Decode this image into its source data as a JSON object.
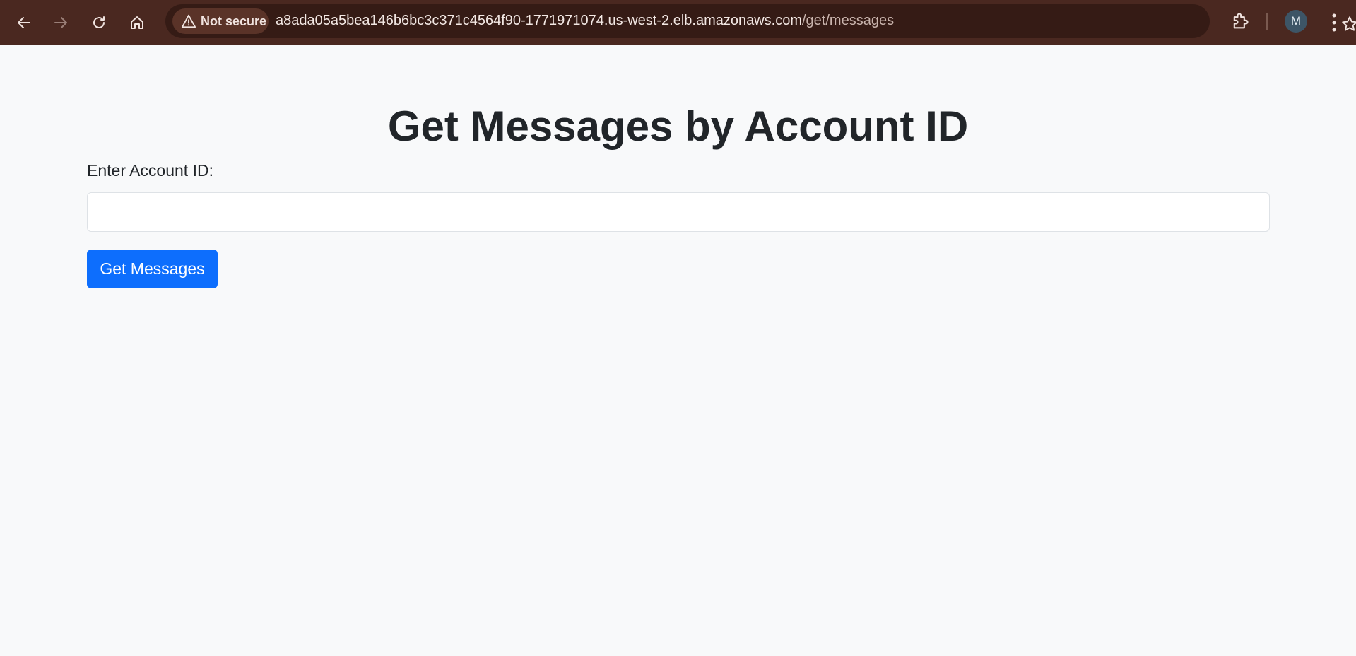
{
  "browser": {
    "security_label": "Not secure",
    "url_host": "a8ada05a5bea146b6bc3c371c4564f90-1771971074.us-west-2.elb.amazonaws.com",
    "url_path": "/get/messages",
    "profile_initial": "M",
    "icons": [
      "back-icon",
      "forward-icon",
      "reload-icon",
      "home-icon",
      "warning-icon",
      "star-icon",
      "extensions-icon",
      "kebab-menu-icon"
    ],
    "colors": {
      "toolbar": "#4a2820",
      "omnibox": "#351b15"
    }
  },
  "page": {
    "title": "Get Messages by Account ID",
    "label": "Enter Account ID:",
    "input_value": "",
    "input_placeholder": "",
    "button_label": "Get Messages",
    "colors": {
      "background": "#f8f9fa",
      "primary": "#0d6efd",
      "text": "#212529"
    }
  }
}
